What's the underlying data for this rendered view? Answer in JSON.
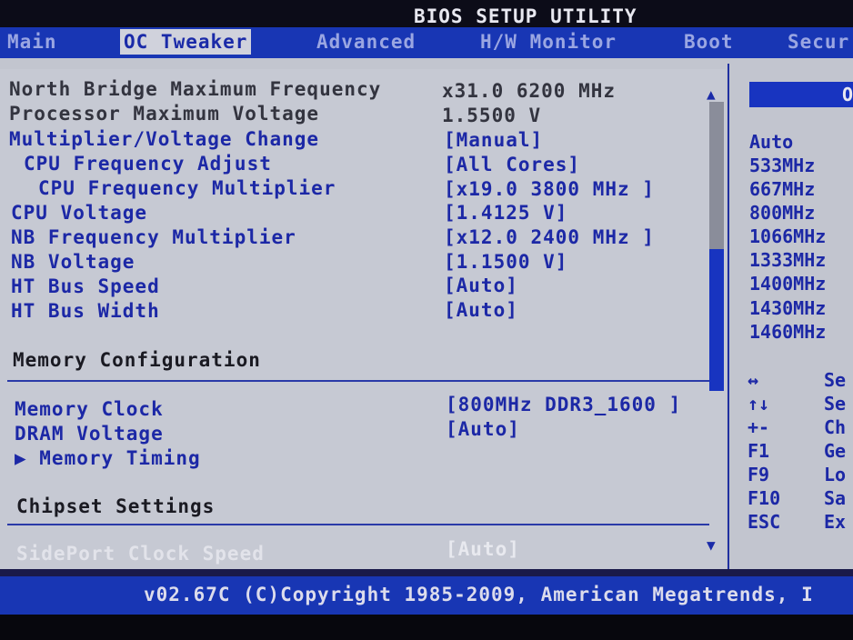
{
  "title": "BIOS SETUP UTILITY",
  "tabs": [
    {
      "label": "Main",
      "active": false
    },
    {
      "label": "OC Tweaker",
      "active": true
    },
    {
      "label": "Advanced",
      "active": false
    },
    {
      "label": "H/W Monitor",
      "active": false
    },
    {
      "label": "Boot",
      "active": false
    },
    {
      "label": "Secur",
      "active": false
    }
  ],
  "settings": [
    {
      "label": "North Bridge Maximum Frequency",
      "value": "x31.0 6200 MHz"
    },
    {
      "label": "Processor Maximum Voltage",
      "value": "1.5500 V"
    },
    {
      "label": "Multiplier/Voltage Change",
      "value": "[Manual]"
    },
    {
      "label": "CPU Frequency Adjust",
      "value": "[All Cores]"
    },
    {
      "label": "CPU Frequency Multiplier",
      "value": "[x19.0 3800 MHz ]"
    },
    {
      "label": "CPU Voltage",
      "value": "[1.4125 V]"
    },
    {
      "label": "NB Frequency Multiplier",
      "value": "[x12.0 2400 MHz ]"
    },
    {
      "label": "NB Voltage",
      "value": "[1.1500 V]"
    },
    {
      "label": "HT Bus Speed",
      "value": "[Auto]"
    },
    {
      "label": "HT Bus Width",
      "value": "[Auto]"
    }
  ],
  "memory_section": {
    "heading": "Memory Configuration",
    "items": [
      {
        "label": "Memory Clock",
        "value": "[800MHz DDR3_1600 ]"
      },
      {
        "label": "DRAM Voltage",
        "value": "[Auto]"
      },
      {
        "label": "▶ Memory Timing",
        "value": ""
      }
    ]
  },
  "chipset_section": {
    "heading": "Chipset Settings",
    "items": [
      {
        "label": "SidePort Clock Speed",
        "value": "[Auto]"
      }
    ]
  },
  "help": {
    "header": "O",
    "options": [
      "Auto",
      "533MHz",
      "667MHz",
      "800MHz",
      "1066MHz",
      "1333MHz",
      "1400MHz",
      "1430MHz",
      "1460MHz"
    ],
    "keys": [
      {
        "key": "↔",
        "action": "Se"
      },
      {
        "key": "↑↓",
        "action": "Se"
      },
      {
        "key": "+-",
        "action": "Ch"
      },
      {
        "key": "F1",
        "action": "Ge"
      },
      {
        "key": "F9",
        "action": "Lo"
      },
      {
        "key": "F10",
        "action": "Sa"
      },
      {
        "key": "ESC",
        "action": "Ex"
      }
    ]
  },
  "footer": "v02.67C (C)Copyright 1985-2009, American Megatrends, I",
  "colors": {
    "accent_blue": "#1836b4",
    "panel_gray": "#c6c9d3",
    "text_blue": "#1c28a6"
  }
}
